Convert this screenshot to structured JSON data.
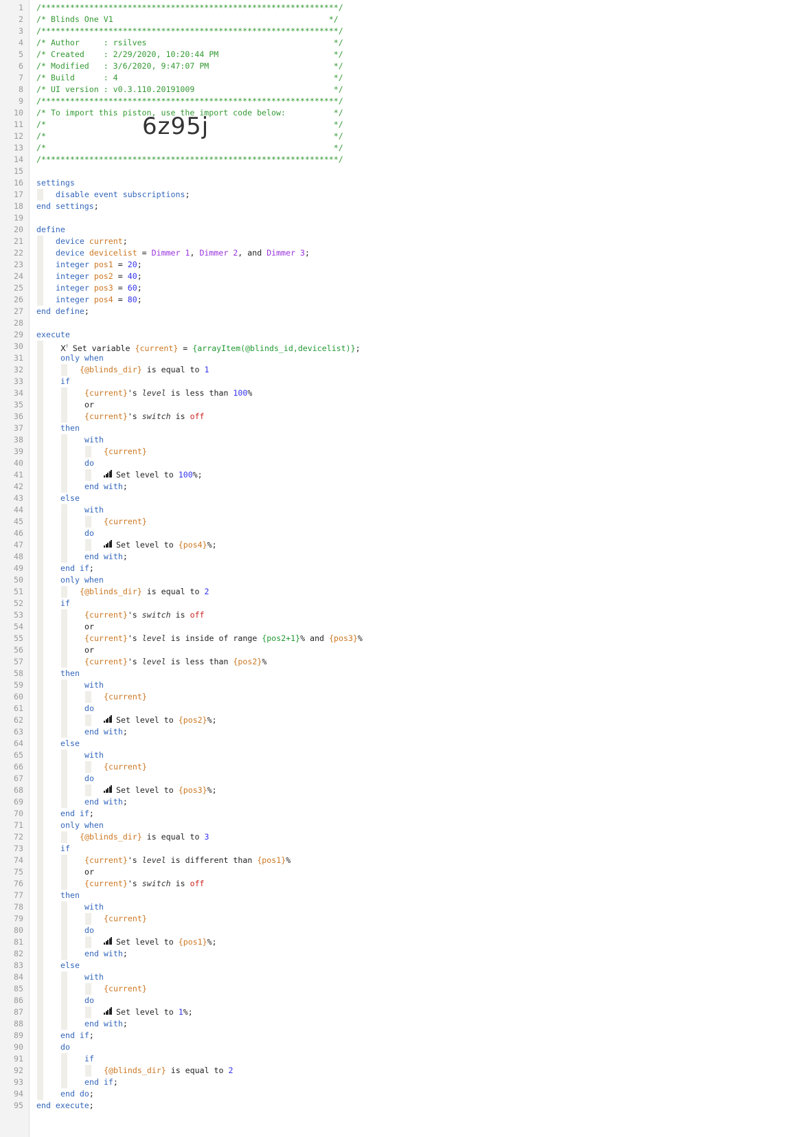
{
  "import_code": "6z95j",
  "icons": {
    "level": "signal-bars-icon",
    "disabled": "x-disabled-icon"
  },
  "colors": {
    "comment": "#339933",
    "keyword": "#3366bb",
    "variable": "#cc7722",
    "number": "#3333ee",
    "device": "#9933dd",
    "off": "#cc2222",
    "gutter": "#f3f3f3"
  },
  "lines": [
    {
      "n": "1",
      "i": 0,
      "t": [
        [
          "c",
          "/**************************************************************/"
        ]
      ]
    },
    {
      "n": "2",
      "i": 0,
      "t": [
        [
          "c",
          "/* Blinds One V1                                             */"
        ]
      ]
    },
    {
      "n": "3",
      "i": 0,
      "t": [
        [
          "c",
          "/**************************************************************/"
        ]
      ]
    },
    {
      "n": "4",
      "i": 0,
      "t": [
        [
          "c",
          "/* Author     : rsilves                                       */"
        ]
      ]
    },
    {
      "n": "5",
      "i": 0,
      "t": [
        [
          "c",
          "/* Created    : 2/29/2020, 10:20:44 PM                        */"
        ]
      ]
    },
    {
      "n": "6",
      "i": 0,
      "t": [
        [
          "c",
          "/* Modified   : 3/6/2020, 9:47:07 PM                          */"
        ]
      ]
    },
    {
      "n": "7",
      "i": 0,
      "t": [
        [
          "c",
          "/* Build      : 4                                             */"
        ]
      ]
    },
    {
      "n": "8",
      "i": 0,
      "t": [
        [
          "c",
          "/* UI version : v0.3.110.20191009                             */"
        ]
      ]
    },
    {
      "n": "9",
      "i": 0,
      "t": [
        [
          "c",
          "/**************************************************************/"
        ]
      ]
    },
    {
      "n": "10",
      "i": 0,
      "t": [
        [
          "c",
          "/* To import this piston, use the import code below:          */"
        ]
      ]
    },
    {
      "n": "11",
      "i": 0,
      "t": [
        [
          "c",
          "/*                                                            */"
        ]
      ]
    },
    {
      "n": "12",
      "i": 0,
      "t": [
        [
          "c",
          "/*                                                            */"
        ]
      ],
      "big": true
    },
    {
      "n": "13",
      "i": 0,
      "t": [
        [
          "c",
          "/*                                                            */"
        ]
      ]
    },
    {
      "n": "14",
      "i": 0,
      "t": [
        [
          "c",
          "/**************************************************************/"
        ]
      ]
    },
    {
      "n": "15",
      "i": 0,
      "t": []
    },
    {
      "n": "16",
      "i": 0,
      "t": [
        [
          "kw",
          "settings"
        ]
      ]
    },
    {
      "n": "17",
      "i": 1,
      "t": [
        [
          "kw",
          "disable event subscriptions"
        ],
        [
          "pl",
          ";"
        ]
      ]
    },
    {
      "n": "18",
      "i": 0,
      "t": [
        [
          "kw",
          "end settings"
        ],
        [
          "pl",
          ";"
        ]
      ]
    },
    {
      "n": "19",
      "i": 0,
      "t": []
    },
    {
      "n": "20",
      "i": 0,
      "t": [
        [
          "kw",
          "define"
        ]
      ]
    },
    {
      "n": "21",
      "i": 1,
      "t": [
        [
          "kw",
          "device "
        ],
        [
          "var",
          "current"
        ],
        [
          "pl",
          ";"
        ]
      ]
    },
    {
      "n": "22",
      "i": 1,
      "t": [
        [
          "kw",
          "device "
        ],
        [
          "var",
          "devicelist"
        ],
        [
          "pl",
          " = "
        ],
        [
          "dev",
          "Dimmer 1"
        ],
        [
          "pl",
          ", "
        ],
        [
          "dev",
          "Dimmer 2"
        ],
        [
          "pl",
          ", and "
        ],
        [
          "dev",
          "Dimmer 3"
        ],
        [
          "pl",
          ";"
        ]
      ]
    },
    {
      "n": "23",
      "i": 1,
      "t": [
        [
          "kw",
          "integer "
        ],
        [
          "var",
          "pos1"
        ],
        [
          "pl",
          " = "
        ],
        [
          "num",
          "20"
        ],
        [
          "pl",
          ";"
        ]
      ]
    },
    {
      "n": "24",
      "i": 1,
      "t": [
        [
          "kw",
          "integer "
        ],
        [
          "var",
          "pos2"
        ],
        [
          "pl",
          " = "
        ],
        [
          "num",
          "40"
        ],
        [
          "pl",
          ";"
        ]
      ]
    },
    {
      "n": "25",
      "i": 1,
      "t": [
        [
          "kw",
          "integer "
        ],
        [
          "var",
          "pos3"
        ],
        [
          "pl",
          " = "
        ],
        [
          "num",
          "60"
        ],
        [
          "pl",
          ";"
        ]
      ]
    },
    {
      "n": "26",
      "i": 1,
      "t": [
        [
          "kw",
          "integer "
        ],
        [
          "var",
          "pos4"
        ],
        [
          "pl",
          " = "
        ],
        [
          "num",
          "80"
        ],
        [
          "pl",
          ";"
        ]
      ]
    },
    {
      "n": "27",
      "i": 0,
      "t": [
        [
          "kw",
          "end define"
        ],
        [
          "pl",
          ";"
        ]
      ]
    },
    {
      "n": "28",
      "i": 0,
      "t": []
    },
    {
      "n": "29",
      "i": 0,
      "t": [
        [
          "kw",
          "execute"
        ]
      ]
    },
    {
      "n": "30",
      "i": 1.25,
      "x": true,
      "t": [
        [
          "pl",
          " Set variable "
        ],
        [
          "var",
          "{current}"
        ],
        [
          "pl",
          " = "
        ],
        [
          "expr",
          "{arrayItem(@blinds_id,devicelist)}"
        ],
        [
          "pl",
          ";"
        ]
      ]
    },
    {
      "n": "31",
      "i": 1.25,
      "t": [
        [
          "kw",
          "only when"
        ]
      ]
    },
    {
      "n": "32",
      "i": 2.25,
      "t": [
        [
          "var",
          "{@blinds_dir}"
        ],
        [
          "pl",
          " is equal to "
        ],
        [
          "num",
          "1"
        ]
      ]
    },
    {
      "n": "33",
      "i": 1.25,
      "t": [
        [
          "kw",
          "if"
        ]
      ]
    },
    {
      "n": "34",
      "i": 2.5,
      "t": [
        [
          "var",
          "{current}"
        ],
        [
          "pl",
          "'s "
        ],
        [
          "attr",
          "level"
        ],
        [
          "pl",
          " is less than "
        ],
        [
          "num",
          "100"
        ],
        [
          "pl",
          "%"
        ]
      ]
    },
    {
      "n": "35",
      "i": 2.5,
      "t": [
        [
          "pl",
          "or"
        ]
      ]
    },
    {
      "n": "36",
      "i": 2.5,
      "t": [
        [
          "var",
          "{current}"
        ],
        [
          "pl",
          "'s "
        ],
        [
          "attr",
          "switch"
        ],
        [
          "pl",
          " is "
        ],
        [
          "red",
          "off"
        ]
      ]
    },
    {
      "n": "37",
      "i": 1.25,
      "t": [
        [
          "kw",
          "then"
        ]
      ]
    },
    {
      "n": "38",
      "i": 2.5,
      "t": [
        [
          "kw",
          "with"
        ]
      ]
    },
    {
      "n": "39",
      "i": 3.5,
      "t": [
        [
          "var",
          "{current}"
        ]
      ]
    },
    {
      "n": "40",
      "i": 2.5,
      "t": [
        [
          "kw",
          "do"
        ]
      ]
    },
    {
      "n": "41",
      "i": 3.5,
      "s": true,
      "t": [
        [
          "pl",
          "Set level to "
        ],
        [
          "num",
          "100"
        ],
        [
          "pl",
          "%;"
        ]
      ]
    },
    {
      "n": "42",
      "i": 2.5,
      "t": [
        [
          "kw",
          "end with"
        ],
        [
          "pl",
          ";"
        ]
      ]
    },
    {
      "n": "43",
      "i": 1.25,
      "t": [
        [
          "kw",
          "else"
        ]
      ]
    },
    {
      "n": "44",
      "i": 2.5,
      "t": [
        [
          "kw",
          "with"
        ]
      ]
    },
    {
      "n": "45",
      "i": 3.5,
      "t": [
        [
          "var",
          "{current}"
        ]
      ]
    },
    {
      "n": "46",
      "i": 2.5,
      "t": [
        [
          "kw",
          "do"
        ]
      ]
    },
    {
      "n": "47",
      "i": 3.5,
      "s": true,
      "t": [
        [
          "pl",
          "Set level to "
        ],
        [
          "var",
          "{pos4}"
        ],
        [
          "pl",
          "%;"
        ]
      ]
    },
    {
      "n": "48",
      "i": 2.5,
      "t": [
        [
          "kw",
          "end with"
        ],
        [
          "pl",
          ";"
        ]
      ]
    },
    {
      "n": "49",
      "i": 1.25,
      "t": [
        [
          "kw",
          "end if"
        ],
        [
          "pl",
          ";"
        ]
      ]
    },
    {
      "n": "50",
      "i": 1.25,
      "t": [
        [
          "kw",
          "only when"
        ]
      ]
    },
    {
      "n": "51",
      "i": 2.25,
      "t": [
        [
          "var",
          "{@blinds_dir}"
        ],
        [
          "pl",
          " is equal to "
        ],
        [
          "num",
          "2"
        ]
      ]
    },
    {
      "n": "52",
      "i": 1.25,
      "t": [
        [
          "kw",
          "if"
        ]
      ]
    },
    {
      "n": "53",
      "i": 2.5,
      "t": [
        [
          "var",
          "{current}"
        ],
        [
          "pl",
          "'s "
        ],
        [
          "attr",
          "switch"
        ],
        [
          "pl",
          " is "
        ],
        [
          "red",
          "off"
        ]
      ]
    },
    {
      "n": "54",
      "i": 2.5,
      "t": [
        [
          "pl",
          "or"
        ]
      ]
    },
    {
      "n": "55",
      "i": 2.5,
      "t": [
        [
          "var",
          "{current}"
        ],
        [
          "pl",
          "'s "
        ],
        [
          "attr",
          "level"
        ],
        [
          "pl",
          " is inside of range "
        ],
        [
          "expr",
          "{pos2+1}"
        ],
        [
          "pl",
          "% and "
        ],
        [
          "var",
          "{pos3}"
        ],
        [
          "pl",
          "%"
        ]
      ]
    },
    {
      "n": "56",
      "i": 2.5,
      "t": [
        [
          "pl",
          "or"
        ]
      ]
    },
    {
      "n": "57",
      "i": 2.5,
      "t": [
        [
          "var",
          "{current}"
        ],
        [
          "pl",
          "'s "
        ],
        [
          "attr",
          "level"
        ],
        [
          "pl",
          " is less than "
        ],
        [
          "var",
          "{pos2}"
        ],
        [
          "pl",
          "%"
        ]
      ]
    },
    {
      "n": "58",
      "i": 1.25,
      "t": [
        [
          "kw",
          "then"
        ]
      ]
    },
    {
      "n": "59",
      "i": 2.5,
      "t": [
        [
          "kw",
          "with"
        ]
      ]
    },
    {
      "n": "60",
      "i": 3.5,
      "t": [
        [
          "var",
          "{current}"
        ]
      ]
    },
    {
      "n": "61",
      "i": 2.5,
      "t": [
        [
          "kw",
          "do"
        ]
      ]
    },
    {
      "n": "62",
      "i": 3.5,
      "s": true,
      "t": [
        [
          "pl",
          "Set level to "
        ],
        [
          "var",
          "{pos2}"
        ],
        [
          "pl",
          "%;"
        ]
      ]
    },
    {
      "n": "63",
      "i": 2.5,
      "t": [
        [
          "kw",
          "end with"
        ],
        [
          "pl",
          ";"
        ]
      ]
    },
    {
      "n": "64",
      "i": 1.25,
      "t": [
        [
          "kw",
          "else"
        ]
      ]
    },
    {
      "n": "65",
      "i": 2.5,
      "t": [
        [
          "kw",
          "with"
        ]
      ]
    },
    {
      "n": "66",
      "i": 3.5,
      "t": [
        [
          "var",
          "{current}"
        ]
      ]
    },
    {
      "n": "67",
      "i": 2.5,
      "t": [
        [
          "kw",
          "do"
        ]
      ]
    },
    {
      "n": "68",
      "i": 3.5,
      "s": true,
      "t": [
        [
          "pl",
          "Set level to "
        ],
        [
          "var",
          "{pos3}"
        ],
        [
          "pl",
          "%;"
        ]
      ]
    },
    {
      "n": "69",
      "i": 2.5,
      "t": [
        [
          "kw",
          "end with"
        ],
        [
          "pl",
          ";"
        ]
      ]
    },
    {
      "n": "70",
      "i": 1.25,
      "t": [
        [
          "kw",
          "end if"
        ],
        [
          "pl",
          ";"
        ]
      ]
    },
    {
      "n": "71",
      "i": 1.25,
      "t": [
        [
          "kw",
          "only when"
        ]
      ]
    },
    {
      "n": "72",
      "i": 2.25,
      "t": [
        [
          "var",
          "{@blinds_dir}"
        ],
        [
          "pl",
          " is equal to "
        ],
        [
          "num",
          "3"
        ]
      ]
    },
    {
      "n": "73",
      "i": 1.25,
      "t": [
        [
          "kw",
          "if"
        ]
      ]
    },
    {
      "n": "74",
      "i": 2.5,
      "t": [
        [
          "var",
          "{current}"
        ],
        [
          "pl",
          "'s "
        ],
        [
          "attr",
          "level"
        ],
        [
          "pl",
          " is different than "
        ],
        [
          "var",
          "{pos1}"
        ],
        [
          "pl",
          "%"
        ]
      ]
    },
    {
      "n": "75",
      "i": 2.5,
      "t": [
        [
          "pl",
          "or"
        ]
      ]
    },
    {
      "n": "76",
      "i": 2.5,
      "t": [
        [
          "var",
          "{current}"
        ],
        [
          "pl",
          "'s "
        ],
        [
          "attr",
          "switch"
        ],
        [
          "pl",
          " is "
        ],
        [
          "red",
          "off"
        ]
      ]
    },
    {
      "n": "77",
      "i": 1.25,
      "t": [
        [
          "kw",
          "then"
        ]
      ]
    },
    {
      "n": "78",
      "i": 2.5,
      "t": [
        [
          "kw",
          "with"
        ]
      ]
    },
    {
      "n": "79",
      "i": 3.5,
      "t": [
        [
          "var",
          "{current}"
        ]
      ]
    },
    {
      "n": "80",
      "i": 2.5,
      "t": [
        [
          "kw",
          "do"
        ]
      ]
    },
    {
      "n": "81",
      "i": 3.5,
      "s": true,
      "t": [
        [
          "pl",
          "Set level to "
        ],
        [
          "var",
          "{pos1}"
        ],
        [
          "pl",
          "%;"
        ]
      ]
    },
    {
      "n": "82",
      "i": 2.5,
      "t": [
        [
          "kw",
          "end with"
        ],
        [
          "pl",
          ";"
        ]
      ]
    },
    {
      "n": "83",
      "i": 1.25,
      "t": [
        [
          "kw",
          "else"
        ]
      ]
    },
    {
      "n": "84",
      "i": 2.5,
      "t": [
        [
          "kw",
          "with"
        ]
      ]
    },
    {
      "n": "85",
      "i": 3.5,
      "t": [
        [
          "var",
          "{current}"
        ]
      ]
    },
    {
      "n": "86",
      "i": 2.5,
      "t": [
        [
          "kw",
          "do"
        ]
      ]
    },
    {
      "n": "87",
      "i": 3.5,
      "s": true,
      "t": [
        [
          "pl",
          "Set level to "
        ],
        [
          "num",
          "1"
        ],
        [
          "pl",
          "%;"
        ]
      ]
    },
    {
      "n": "88",
      "i": 2.5,
      "t": [
        [
          "kw",
          "end with"
        ],
        [
          "pl",
          ";"
        ]
      ]
    },
    {
      "n": "89",
      "i": 1.25,
      "t": [
        [
          "kw",
          "end if"
        ],
        [
          "pl",
          ";"
        ]
      ]
    },
    {
      "n": "90",
      "i": 1.25,
      "t": [
        [
          "kw",
          "do"
        ]
      ]
    },
    {
      "n": "91",
      "i": 2.5,
      "t": [
        [
          "kw",
          "if"
        ]
      ]
    },
    {
      "n": "92",
      "i": 3.5,
      "t": [
        [
          "var",
          "{@blinds_dir}"
        ],
        [
          "pl",
          " is equal to "
        ],
        [
          "num",
          "2"
        ]
      ]
    },
    {
      "n": "93",
      "i": 2.5,
      "t": [
        [
          "kw",
          "end if"
        ],
        [
          "pl",
          ";"
        ]
      ]
    },
    {
      "n": "94",
      "i": 1.25,
      "t": [
        [
          "kw",
          "end do"
        ],
        [
          "pl",
          ";"
        ]
      ]
    },
    {
      "n": "95",
      "i": 0,
      "t": [
        [
          "kw",
          "end execute"
        ],
        [
          "pl",
          ";"
        ]
      ]
    }
  ]
}
